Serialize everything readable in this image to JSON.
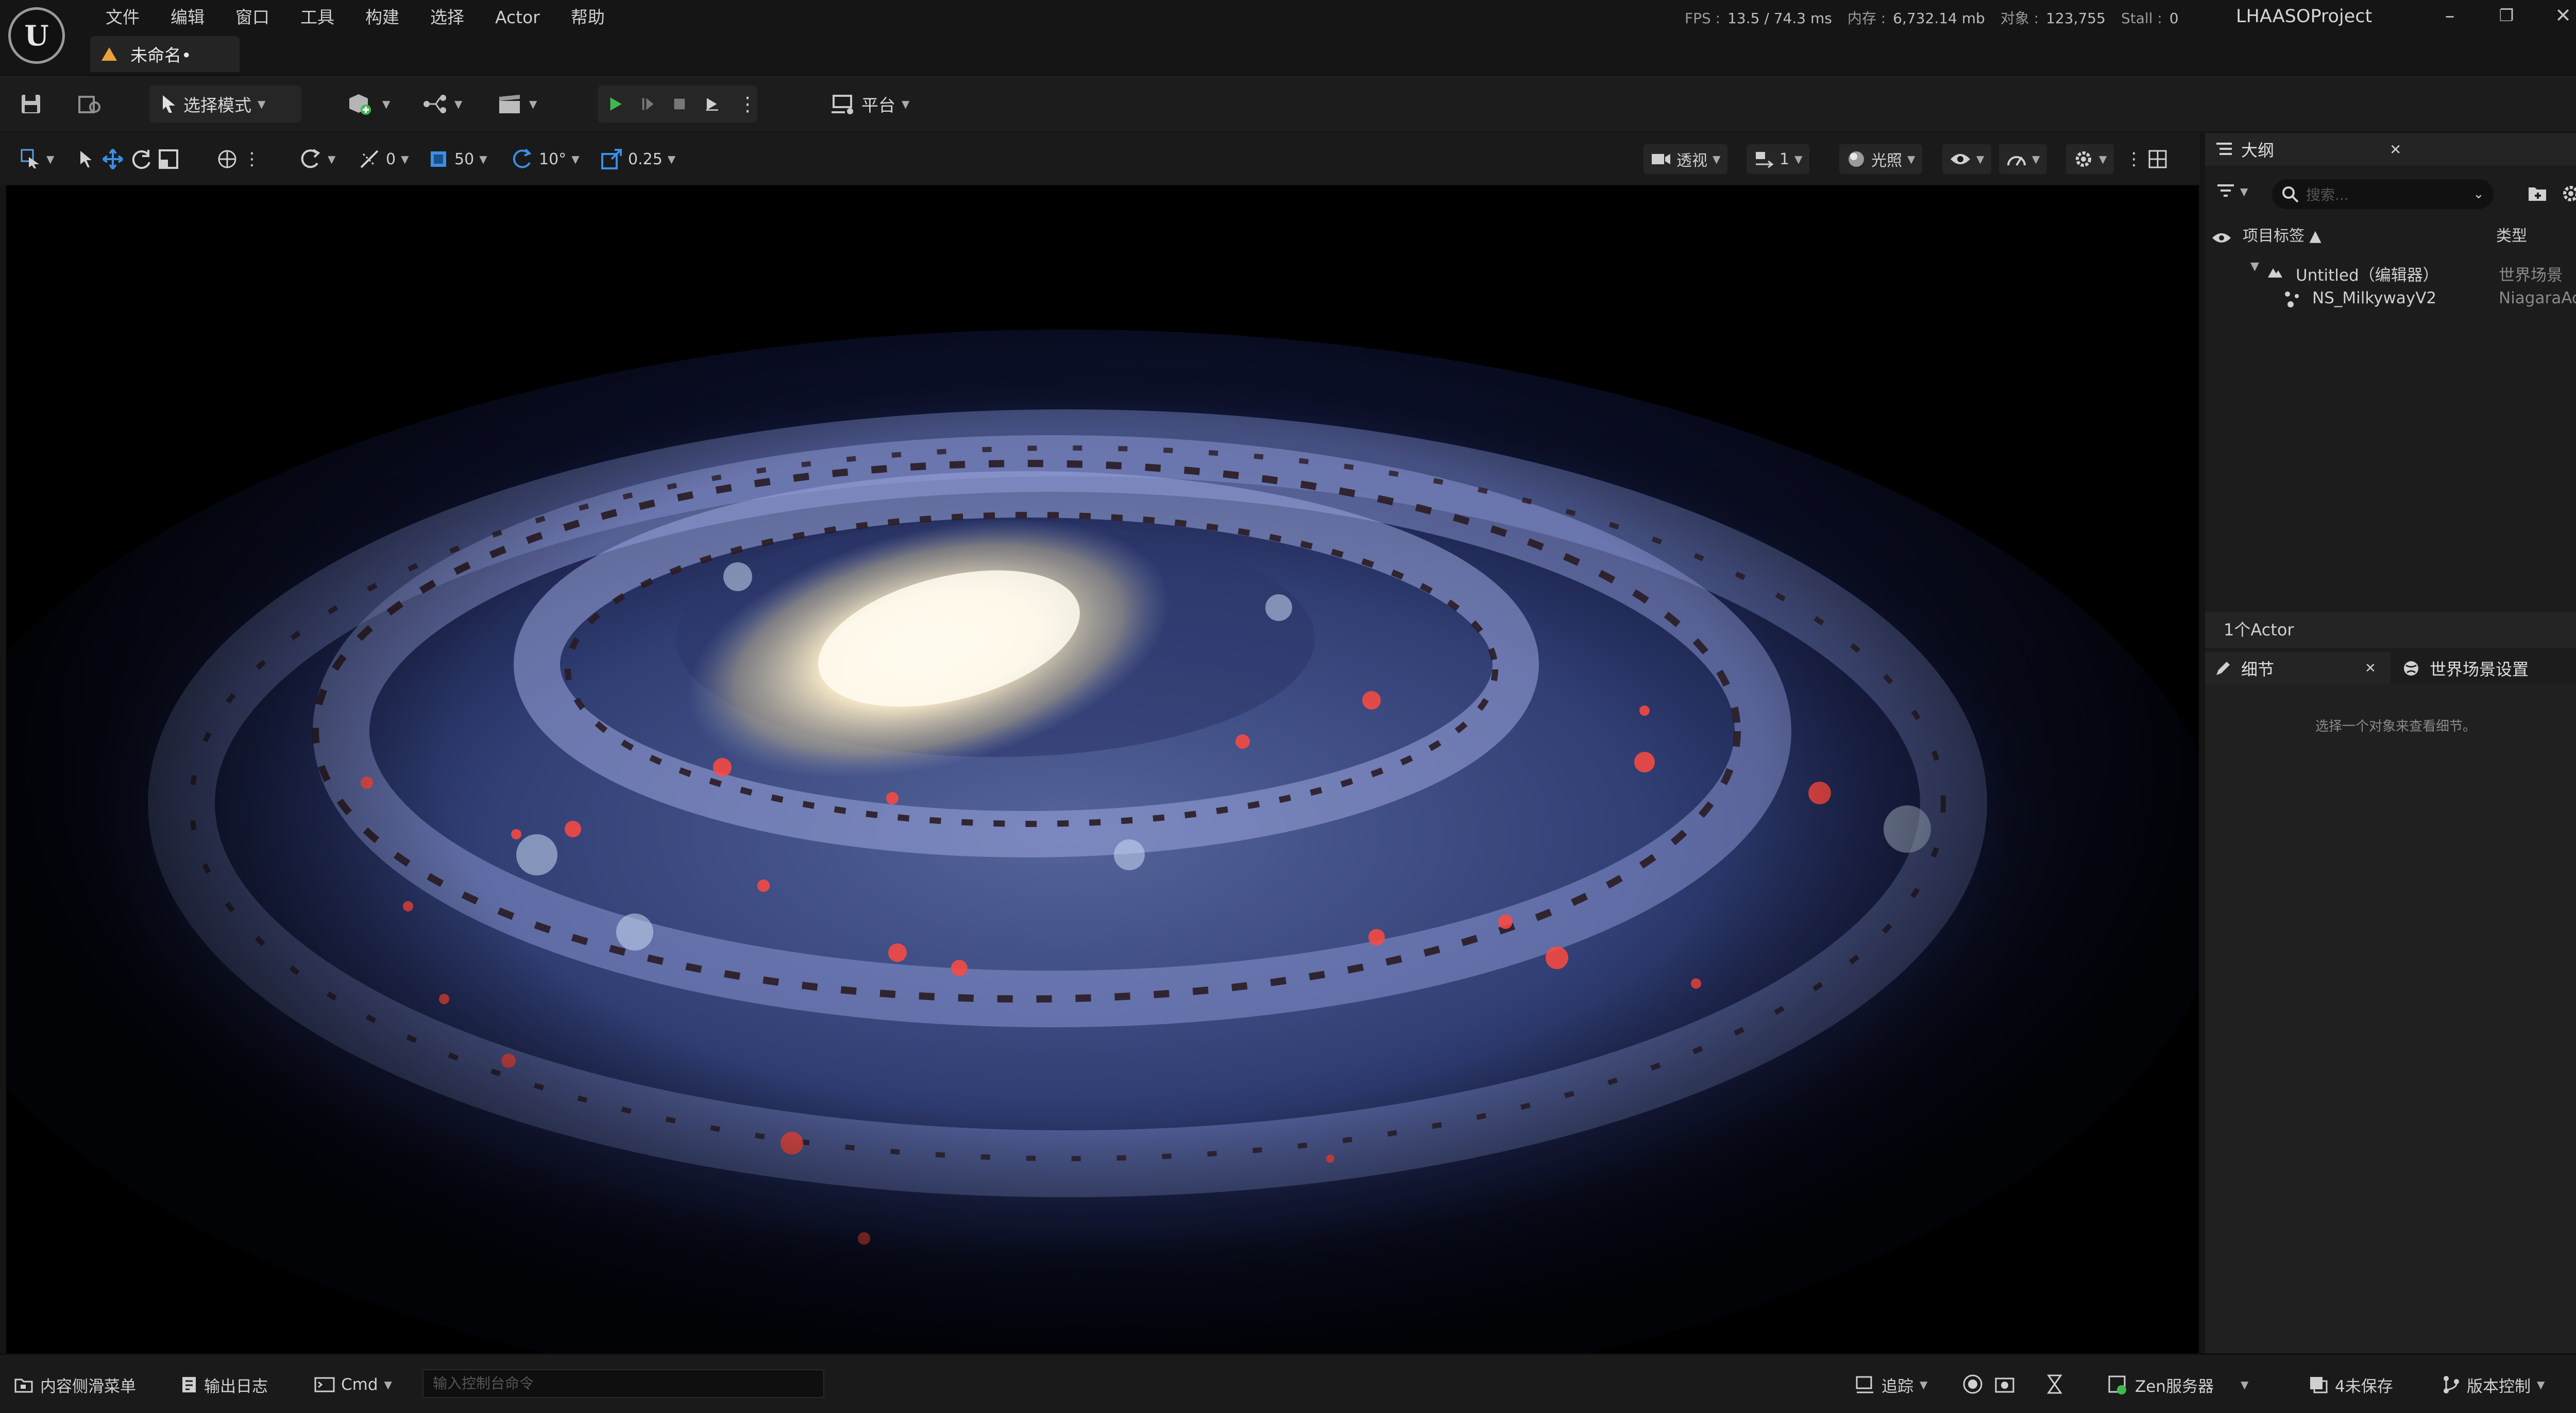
{
  "titlebar": {
    "logo": "U",
    "menu": [
      "文件",
      "编辑",
      "窗口",
      "工具",
      "构建",
      "选择",
      "Actor",
      "帮助"
    ],
    "document_tab": "未命名•",
    "stats": {
      "fps_label": "FPS :",
      "fps": "13.5",
      "ms": "/ 74.3 ms",
      "mem_label": "内存 :",
      "mem": "6,732.14 mb",
      "obj_label": "对象 :",
      "obj": "123,755",
      "stall_label": "Stall :",
      "stall": "0"
    },
    "project": "LHAASOProject",
    "window_buttons": [
      "–",
      "❐",
      "✕"
    ]
  },
  "toolbar": {
    "mode_label": "选择模式",
    "platform_label": "平台"
  },
  "viewport_toolbar": {
    "rotation_snap": "0",
    "grid_snap": "50",
    "angle_snap": "10°",
    "scale_snap": "0.25",
    "view_mode": "透视",
    "camera_speed": "1",
    "lighting": "光照"
  },
  "outliner": {
    "title": "大纲",
    "search_placeholder": "搜索...",
    "col_label": "项目标签 ▲",
    "col_type": "类型",
    "rows": [
      {
        "label": "Untitled（编辑器）",
        "type": "世界场景"
      },
      {
        "label": "NS_MilkywayV2",
        "type": "NiagaraAct"
      }
    ],
    "actor_count": "1个Actor"
  },
  "details": {
    "tab_details": "细节",
    "tab_world": "世界场景设置",
    "empty_hint": "选择一个对象来查看细节。"
  },
  "bottombar": {
    "content_drawer": "内容侧滑菜单",
    "output_log": "输出日志",
    "cmd": "Cmd",
    "cmd_placeholder": "输入控制台命令",
    "trace": "追踪",
    "zen": "Zen服务器",
    "unsaved": "4未保存",
    "source_control": "版本控制"
  },
  "colors": {
    "accent_green": "#3fb94f",
    "select_blue": "#3a8fe8",
    "bg": "#151515"
  }
}
